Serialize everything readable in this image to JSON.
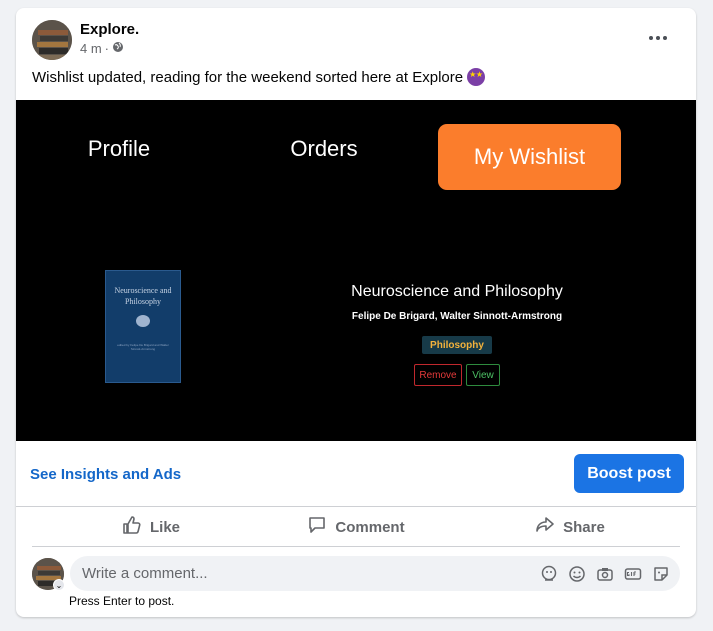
{
  "post": {
    "page_name": "Explore.",
    "time": "4 m",
    "separator": "·",
    "caption": "Wishlist updated, reading for the weekend sorted here at Explore"
  },
  "media": {
    "tabs": [
      "Profile",
      "Orders",
      "My Wishlist"
    ],
    "active_tab": "My Wishlist",
    "book": {
      "cover_title": "Neuroscience and Philosophy",
      "cover_editors": "edited by Felipe De Brigard and Walter Sinnott-Armstrong",
      "title": "Neuroscience and Philosophy",
      "authors": "Felipe De Brigard, Walter Sinnott-Armstrong",
      "genre": "Philosophy",
      "remove_label": "Remove",
      "view_label": "View"
    }
  },
  "insights_label": "See Insights and Ads",
  "boost_label": "Boost post",
  "actions": {
    "like": "Like",
    "comment": "Comment",
    "share": "Share"
  },
  "comment": {
    "placeholder": "Write a comment...",
    "hint": "Press Enter to post."
  },
  "colors": {
    "accent": "#1b74e4",
    "link": "#1467c9",
    "wishlist_tab": "#fb7d2c",
    "remove": "#e33a3a",
    "view": "#4cc064",
    "genre_text": "#f3b23c"
  }
}
